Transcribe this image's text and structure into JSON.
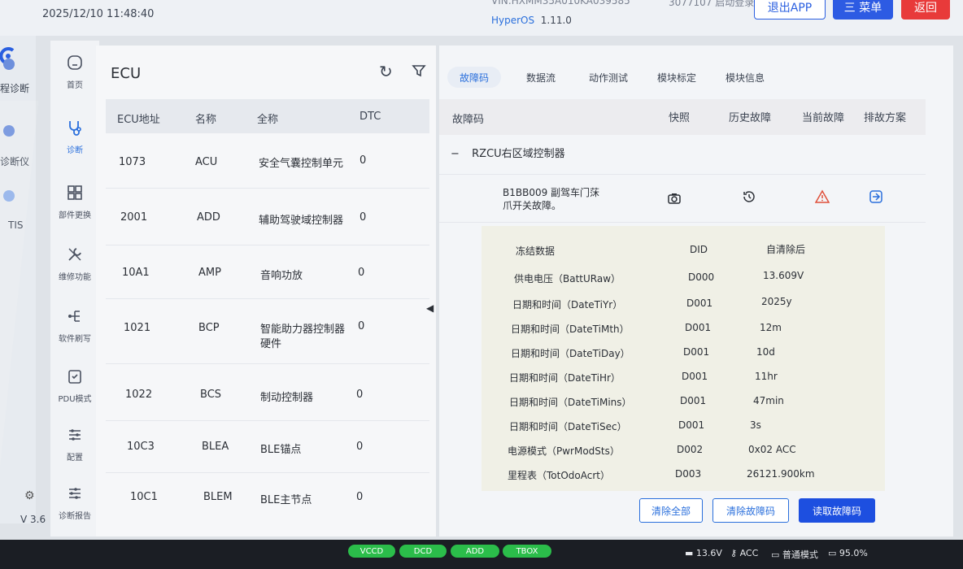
{
  "header": {
    "datetime": "2025/12/10 11:48:40",
    "vin": "VIN:HXMM35A010KA039585",
    "status_text": "3077107 启动登录",
    "os_brand": "HyperOS",
    "os_version": "1.11.0",
    "exit_label": "退出APP",
    "menu_label": "三 菜单",
    "back_label": "返回"
  },
  "farleft": {
    "items": [
      {
        "label": "程诊断",
        "icon": "cloud-icon"
      },
      {
        "label": "诊断仪",
        "icon": "scanner-icon"
      },
      {
        "label": "TIS",
        "icon": "tis-icon"
      }
    ]
  },
  "sidebar": {
    "items": [
      {
        "label": "首页",
        "icon": "home-icon"
      },
      {
        "label": "诊断",
        "icon": "stethoscope-icon",
        "active": true
      },
      {
        "label": "部件更换",
        "icon": "parts-icon"
      },
      {
        "label": "维修功能",
        "icon": "wrench-icon"
      },
      {
        "label": "软件刷写",
        "icon": "flash-icon"
      },
      {
        "label": "PDU模式",
        "icon": "clipboard-icon"
      },
      {
        "label": "配置",
        "icon": "sliders-icon"
      },
      {
        "label": "诊断报告",
        "icon": "report-icon"
      }
    ],
    "version": "V 3.6"
  },
  "ecu": {
    "title": "ECU",
    "headers": [
      "ECU地址",
      "名称",
      "全称",
      "DTC"
    ],
    "rows": [
      {
        "addr": "1073",
        "name": "ACU",
        "full1": "安全气囊控制单元",
        "full2": "",
        "dtc": "0"
      },
      {
        "addr": "2001",
        "name": "ADD",
        "full1": "辅助驾驶域控制器",
        "full2": "",
        "dtc": "0"
      },
      {
        "addr": "10A1",
        "name": "AMP",
        "full1": "音响功放",
        "full2": "",
        "dtc": "0"
      },
      {
        "addr": "1021",
        "name": "BCP",
        "full1": "智能助力器控制器",
        "full2": "硬件",
        "dtc": "0"
      },
      {
        "addr": "1022",
        "name": "BCS",
        "full1": "制动控制器",
        "full2": "",
        "dtc": "0"
      },
      {
        "addr": "10C3",
        "name": "BLEA",
        "full1": "BLE锚点",
        "full2": "",
        "dtc": "0"
      },
      {
        "addr": "10C1",
        "name": "BLEM",
        "full1": "BLE主节点",
        "full2": "",
        "dtc": "0"
      }
    ]
  },
  "tabs": [
    "故障码",
    "数据流",
    "动作测试",
    "模块标定",
    "模块信息"
  ],
  "dtc": {
    "headers": [
      "故障码",
      "快照",
      "历史故障",
      "当前故障",
      "排故方案"
    ],
    "group": "RZCU右区域控制器",
    "code_line1": "B1BB009 副驾车门莯",
    "code_line2": "爪开关故障。"
  },
  "freeze": {
    "headers": [
      "冻结数据",
      "DID",
      "自清除后"
    ],
    "rows": [
      {
        "name": "供电电压（BattURaw）",
        "did": "D000",
        "val": "13.609V"
      },
      {
        "name": "日期和时间（DateTiYr）",
        "did": "D001",
        "val": "2025y"
      },
      {
        "name": "日期和时间（DateTiMth）",
        "did": "D001",
        "val": "12m"
      },
      {
        "name": "日期和时间（DateTiDay）",
        "did": "D001",
        "val": "10d"
      },
      {
        "name": "日期和时间（DateTiHr）",
        "did": "D001",
        "val": "11hr"
      },
      {
        "name": "日期和时间（DateTiMins）",
        "did": "D001",
        "val": "47min"
      },
      {
        "name": "日期和时间（DateTiSec）",
        "did": "D001",
        "val": "3s"
      },
      {
        "name": "电源模式（PwrModSts）",
        "did": "D002",
        "val": "0x02 ACC"
      },
      {
        "name": "里程表（TotOdoAcrt）",
        "did": "D003",
        "val": "26121.900km"
      }
    ]
  },
  "actions": {
    "clear_all": "清除全部",
    "clear_dtc": "清除故障码",
    "read_dtc": "读取故障码"
  },
  "bottom": {
    "pills": [
      "VCCD",
      "DCD",
      "ADD",
      "TBOX"
    ],
    "voltage": "13.6V",
    "power": "ACC",
    "mode": "普通模式",
    "battery": "95.0%"
  },
  "colors": {
    "accent": "#2a6fdc",
    "primary_button": "#1d4fe0",
    "back_button": "#e83a3a",
    "pill_green": "#2bbd4a",
    "warning_red": "#e0503a"
  }
}
